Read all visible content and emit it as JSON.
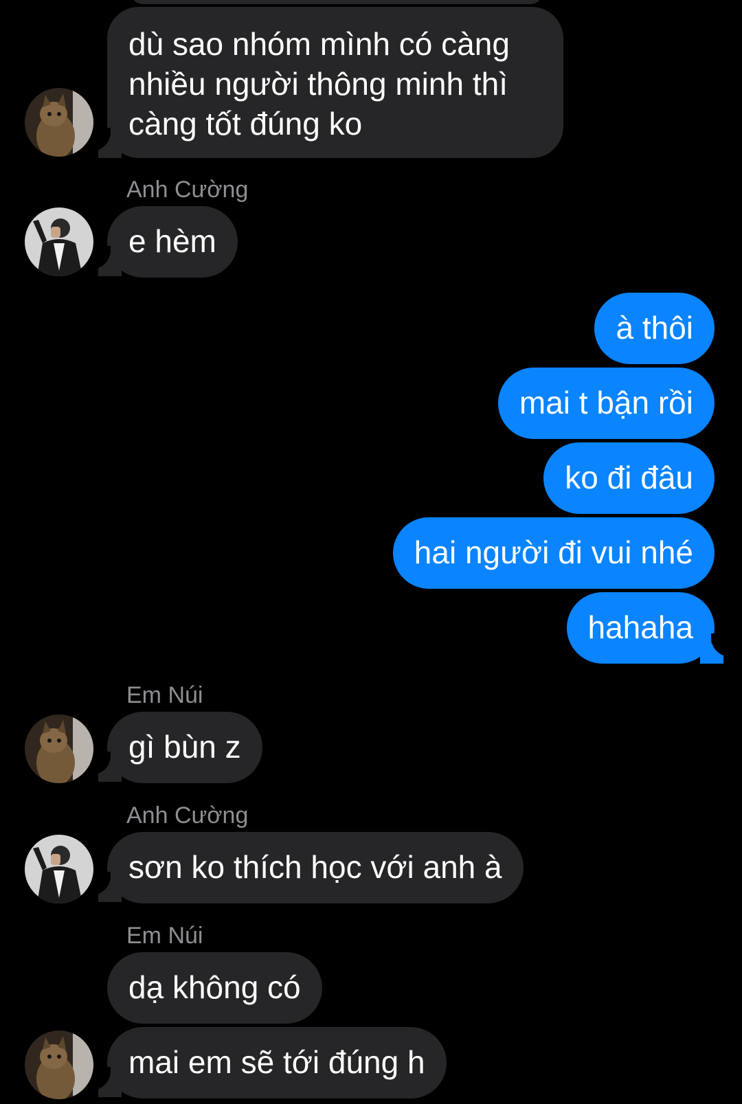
{
  "conversation": {
    "messages": [
      {
        "text": "dù sao nhóm mình có càng nhiều người thông minh thì càng tốt đúng ko"
      },
      {
        "sender": "Anh Cường",
        "text": "e hèm"
      },
      {
        "text": "à thôi"
      },
      {
        "text": "mai t bận rồi"
      },
      {
        "text": "ko đi đâu"
      },
      {
        "text": "hai người đi vui nhé"
      },
      {
        "text": "hahaha"
      },
      {
        "sender": "Em Núi",
        "text": "gì bùn z"
      },
      {
        "sender": "Anh Cường",
        "text": "sơn ko thích học với anh à"
      },
      {
        "sender": "Em Núi",
        "text": "dạ không có"
      },
      {
        "text": "mai em sẽ tới đúng h"
      }
    ]
  },
  "avatars": {
    "em_nui": "cat-photo-avatar",
    "anh_cuong": "person-photo-avatar"
  },
  "colors": {
    "background": "#000000",
    "incoming_bubble": "#262628",
    "outgoing_bubble": "#0a84ff",
    "sender_name": "#8e8e93",
    "text": "#ffffff"
  }
}
